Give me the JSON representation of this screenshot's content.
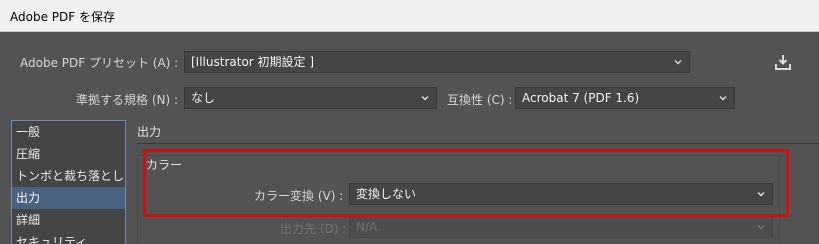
{
  "window": {
    "title": "Adobe PDF を保存"
  },
  "top": {
    "preset_label": "Adobe PDF プリセット (A) :",
    "preset_value": "[Illustrator 初期設定 ]",
    "standard_label": "準拠する規格 (N) :",
    "standard_value": "なし",
    "compat_label": "互換性 (C) :",
    "compat_value": "Acrobat 7 (PDF 1.6)",
    "save_preset_icon": "download-tray-icon"
  },
  "sidebar": {
    "items": [
      {
        "label": "一般",
        "selected": false
      },
      {
        "label": "圧縮",
        "selected": false
      },
      {
        "label": "トンボと裁ち落とし",
        "selected": false
      },
      {
        "label": "出力",
        "selected": true
      },
      {
        "label": "詳細",
        "selected": false
      },
      {
        "label": "セキュリティ",
        "selected": false
      }
    ]
  },
  "panel": {
    "title": "出力",
    "color_group": {
      "title": "カラー",
      "conversion_label": "カラー変換 (V) :",
      "conversion_value": "変換しない",
      "destination_label": "出力先 (D) :",
      "destination_value": "N/A"
    }
  },
  "colors": {
    "background": "#535353",
    "field": "#454545",
    "selection": "#4a6280",
    "highlight": "#d01010"
  }
}
